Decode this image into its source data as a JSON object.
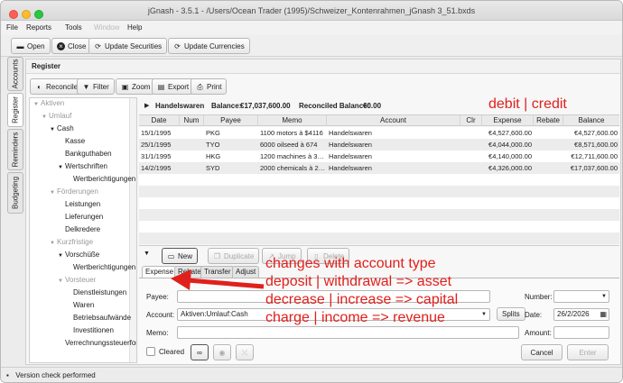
{
  "window": {
    "title": "jGnash - 3.5.1 - /Users/Ocean Trader (1995)/Schweizer_Kontenrahmen_jGnash 3_51.bxds",
    "menu": [
      "File",
      "Reports",
      "Tools",
      "Window",
      "Help"
    ]
  },
  "toolbar": {
    "open": "Open",
    "close": "Close",
    "update_securities": "Update Securities",
    "update_currencies": "Update Currencies"
  },
  "side_tabs": [
    "Accounts",
    "Register",
    "Reminders",
    "Budgeting"
  ],
  "register": {
    "title": "Register",
    "buttons": {
      "reconcile": "Reconcile",
      "filter": "Filter",
      "zoom": "Zoom",
      "export": "Export",
      "print": "Print"
    }
  },
  "tree": [
    {
      "label": "Aktiven",
      "level": 0,
      "grey": true,
      "expanded": true
    },
    {
      "label": "Umlauf",
      "level": 1,
      "grey": true,
      "expanded": true
    },
    {
      "label": "Cash",
      "level": 2,
      "grey": false,
      "expanded": true
    },
    {
      "label": "Kasse",
      "level": 3,
      "grey": false
    },
    {
      "label": "Bankguthaben",
      "level": 3,
      "grey": false
    },
    {
      "label": "Wertschriften",
      "level": 3,
      "grey": false,
      "expanded": true
    },
    {
      "label": "Wertberichtigungen",
      "level": 4,
      "grey": false
    },
    {
      "label": "Förderungen",
      "level": 2,
      "grey": true,
      "expanded": true
    },
    {
      "label": "Leistungen",
      "level": 3,
      "grey": false
    },
    {
      "label": "Lieferungen",
      "level": 3,
      "grey": false
    },
    {
      "label": "Delkredere",
      "level": 3,
      "grey": false
    },
    {
      "label": "Kurzfristige",
      "level": 2,
      "grey": true,
      "expanded": true
    },
    {
      "label": "Vorschüße",
      "level": 3,
      "grey": false,
      "expanded": true
    },
    {
      "label": "Wertberichtigungen",
      "level": 4,
      "grey": false
    },
    {
      "label": "Vorsteuer",
      "level": 3,
      "grey": true,
      "expanded": true
    },
    {
      "label": "Dienstleistungen",
      "level": 4,
      "grey": false
    },
    {
      "label": "Waren",
      "level": 4,
      "grey": false
    },
    {
      "label": "Betriebsaufwände",
      "level": 4,
      "grey": false
    },
    {
      "label": "Investitionen",
      "level": 4,
      "grey": false
    },
    {
      "label": "Verrechnungssteuerford",
      "level": 3,
      "grey": false
    }
  ],
  "account_bar": {
    "name": "Handelswaren",
    "balance_label": "Balance:",
    "balance": "€17,037,600.00",
    "reconciled_label": "Reconciled Balance:",
    "reconciled": "€0.00"
  },
  "columns": [
    "Date",
    "Num",
    "Payee",
    "Memo",
    "Account",
    "Clr",
    "Expense",
    "Rebate",
    "Balance"
  ],
  "rows": [
    {
      "date": "15/1/1995",
      "num": "",
      "payee": "PKG",
      "memo": "1100 motors à $4116",
      "account": "Handelswaren",
      "clr": "",
      "expense": "€4,527,600.00",
      "rebate": "",
      "balance": "€4,527,600.00"
    },
    {
      "date": "25/1/1995",
      "num": "",
      "payee": "TYO",
      "memo": "6000 oilseed à 674",
      "account": "Handelswaren",
      "clr": "",
      "expense": "€4,044,000.00",
      "rebate": "",
      "balance": "€8,571,600.00"
    },
    {
      "date": "31/1/1995",
      "num": "",
      "payee": "HKG",
      "memo": "1200 machines à 3…",
      "account": "Handelswaren",
      "clr": "",
      "expense": "€4,140,000.00",
      "rebate": "",
      "balance": "€12,711,600.00"
    },
    {
      "date": "14/2/1995",
      "num": "",
      "payee": "SYD",
      "memo": "2000 chemicals à 2…",
      "account": "Handelswaren",
      "clr": "",
      "expense": "€4,326,000.00",
      "rebate": "",
      "balance": "€17,037,600.00"
    }
  ],
  "tx_buttons": {
    "new": "New",
    "duplicate": "Duplicate",
    "jump": "Jump",
    "delete": "Delete"
  },
  "tx_tabs": [
    "Expense",
    "Rebate",
    "Transfer",
    "Adjust"
  ],
  "form": {
    "payee_label": "Payee:",
    "number_label": "Number:",
    "account_label": "Account:",
    "account_value": "Aktiven:Umlauf:Cash",
    "splits": "Splits",
    "date_label": "Date:",
    "date_value": "26/2/2026",
    "memo_label": "Memo:",
    "amount_label": "Amount:",
    "cleared": "Cleared",
    "cancel": "Cancel",
    "enter": "Enter"
  },
  "status": "Version check performed",
  "annotations": {
    "top": "debit | credit",
    "line1": "changes with account type",
    "line2": "deposit | withdrawal => asset",
    "line3": "decrease | increase => capital",
    "line4": "charge | income => revenue",
    "color": "#e0201c"
  }
}
